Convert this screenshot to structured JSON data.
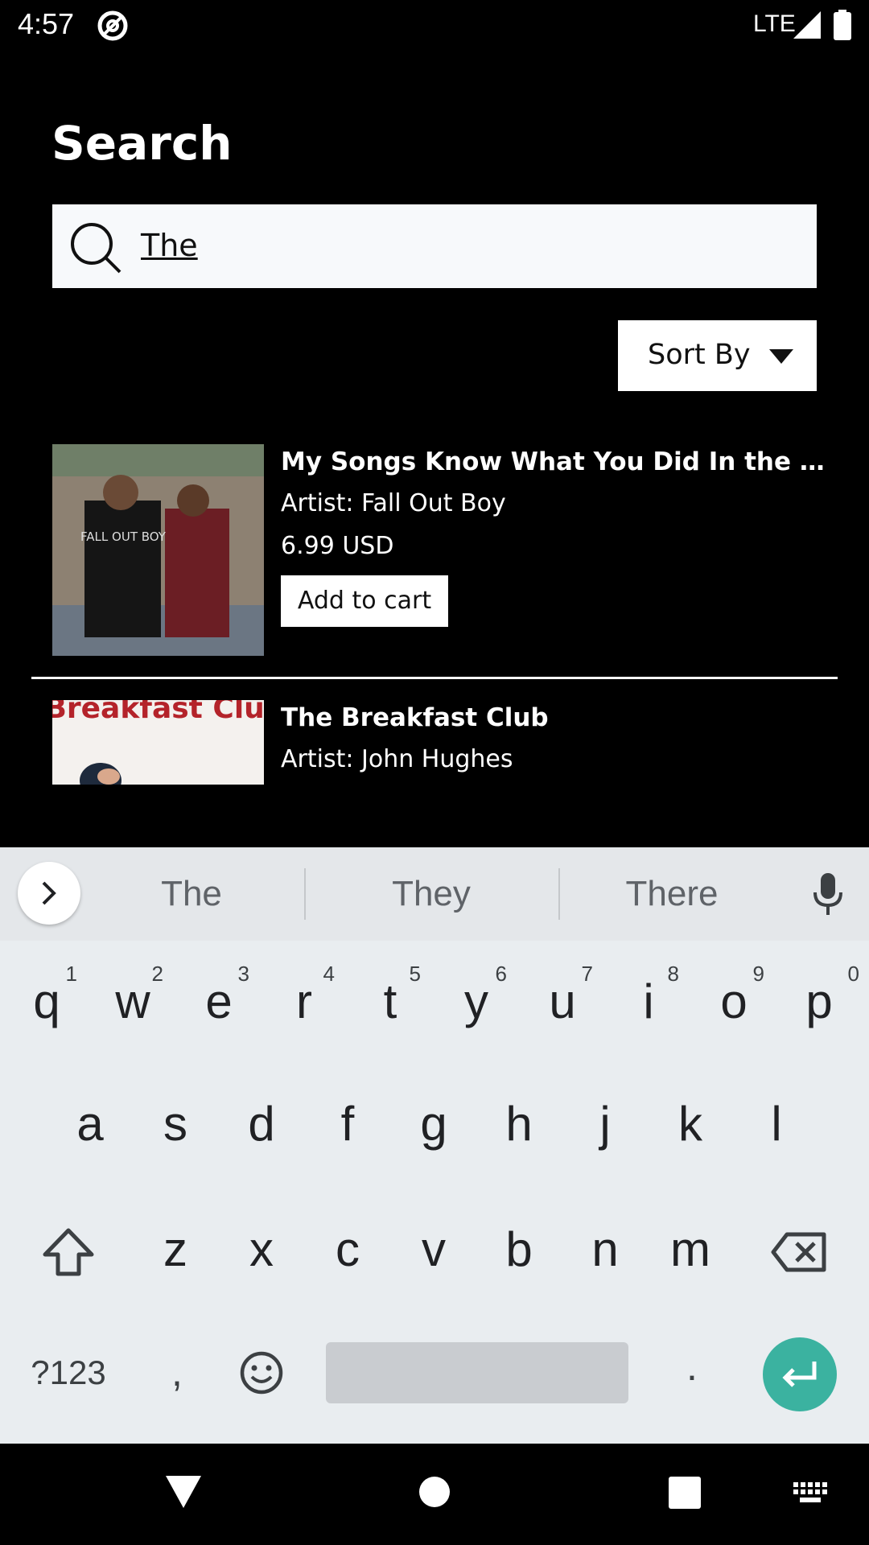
{
  "status_bar": {
    "time": "4:57",
    "network": "LTE",
    "icons": [
      "at-sign-icon",
      "signal-icon",
      "battery-icon"
    ]
  },
  "page": {
    "title": "Search"
  },
  "search": {
    "value": "The",
    "icon": "search-icon"
  },
  "sort": {
    "label": "Sort By",
    "icon": "caret-down-icon"
  },
  "results": [
    {
      "title": "My Songs Know What You Did In the …",
      "artist": "Artist: Fall Out Boy",
      "price": "6.99 USD",
      "cart_label": "Add to cart",
      "image_text": "FALL OUT BOY"
    },
    {
      "title": "The Breakfast Club",
      "artist": "Artist: John Hughes",
      "image_text": "Breakfast Club"
    }
  ],
  "keyboard": {
    "suggestions": [
      "The",
      "They",
      "There"
    ],
    "row1": [
      {
        "key": "q",
        "hint": "1"
      },
      {
        "key": "w",
        "hint": "2"
      },
      {
        "key": "e",
        "hint": "3"
      },
      {
        "key": "r",
        "hint": "4"
      },
      {
        "key": "t",
        "hint": "5"
      },
      {
        "key": "y",
        "hint": "6"
      },
      {
        "key": "u",
        "hint": "7"
      },
      {
        "key": "i",
        "hint": "8"
      },
      {
        "key": "o",
        "hint": "9"
      },
      {
        "key": "p",
        "hint": "0"
      }
    ],
    "row2": [
      "a",
      "s",
      "d",
      "f",
      "g",
      "h",
      "j",
      "k",
      "l"
    ],
    "row3": [
      "z",
      "x",
      "c",
      "v",
      "b",
      "n",
      "m"
    ],
    "symbols_label": "?123",
    "comma": ",",
    "period": ".",
    "accent_color": "#3bb2a0"
  },
  "nav": {
    "icons": [
      "back-icon",
      "home-icon",
      "recents-icon",
      "keyboard-icon"
    ]
  }
}
